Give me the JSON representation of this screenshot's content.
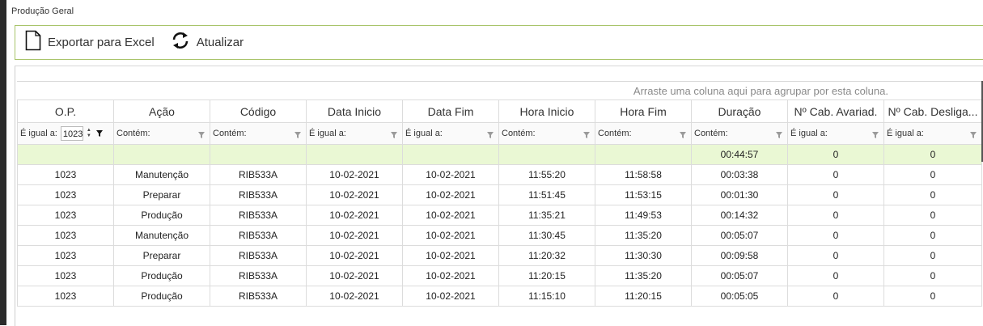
{
  "window": {
    "title": "Produção Geral"
  },
  "toolbar": {
    "export_label": "Exportar para Excel",
    "refresh_label": "Atualizar"
  },
  "grid": {
    "group_hint": "Arraste uma coluna aqui para agrupar por esta coluna.",
    "columns": [
      "O.P.",
      "Ação",
      "Código",
      "Data Inicio",
      "Data Fim",
      "Hora Inicio",
      "Hora Fim",
      "Duração",
      "Nº Cab. Avariad.",
      "Nº Cab. Desliga..."
    ],
    "filters": [
      "É igual a:",
      "Contém:",
      "Contém:",
      "É igual a:",
      "É igual a:",
      "Contém:",
      "Contém:",
      "Contém:",
      "É igual a:",
      "É igual a:"
    ],
    "op_filter_value": "1023",
    "summary": [
      "",
      "",
      "",
      "",
      "",
      "",
      "",
      "00:44:57",
      "0",
      "0"
    ],
    "rows": [
      [
        "1023",
        "Manutenção",
        "RIB533A",
        "10-02-2021",
        "10-02-2021",
        "11:55:20",
        "11:58:58",
        "00:03:38",
        "0",
        "0"
      ],
      [
        "1023",
        "Preparar",
        "RIB533A",
        "10-02-2021",
        "10-02-2021",
        "11:51:45",
        "11:53:15",
        "00:01:30",
        "0",
        "0"
      ],
      [
        "1023",
        "Produção",
        "RIB533A",
        "10-02-2021",
        "10-02-2021",
        "11:35:21",
        "11:49:53",
        "00:14:32",
        "0",
        "0"
      ],
      [
        "1023",
        "Manutenção",
        "RIB533A",
        "10-02-2021",
        "10-02-2021",
        "11:30:45",
        "11:35:20",
        "00:05:07",
        "0",
        "0"
      ],
      [
        "1023",
        "Preparar",
        "RIB533A",
        "10-02-2021",
        "10-02-2021",
        "11:20:32",
        "11:30:30",
        "00:09:58",
        "0",
        "0"
      ],
      [
        "1023",
        "Produção",
        "RIB533A",
        "10-02-2021",
        "10-02-2021",
        "11:20:15",
        "11:35:20",
        "00:05:07",
        "0",
        "0"
      ],
      [
        "1023",
        "Produção",
        "RIB533A",
        "10-02-2021",
        "10-02-2021",
        "11:15:10",
        "11:20:15",
        "00:05:05",
        "0",
        "0"
      ]
    ]
  },
  "icons": {
    "export": "document-icon",
    "refresh": "refresh-icon",
    "filter": "funnel-icon",
    "spin": "spin-arrows-icon"
  },
  "colors": {
    "toolbar_border": "#a8c46a",
    "summary_row_bg": "#eaf8d4"
  }
}
